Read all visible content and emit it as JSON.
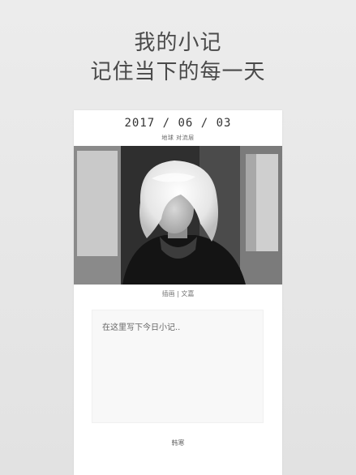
{
  "header": {
    "line1": "我的小记",
    "line2": "记住当下的每一天"
  },
  "card": {
    "date": "2017 / 06 / 03",
    "location": "地球  对流层",
    "credit": "插画 | 文嘉",
    "note_placeholder": "在这里写下今日小记..",
    "author": "韩寒"
  }
}
